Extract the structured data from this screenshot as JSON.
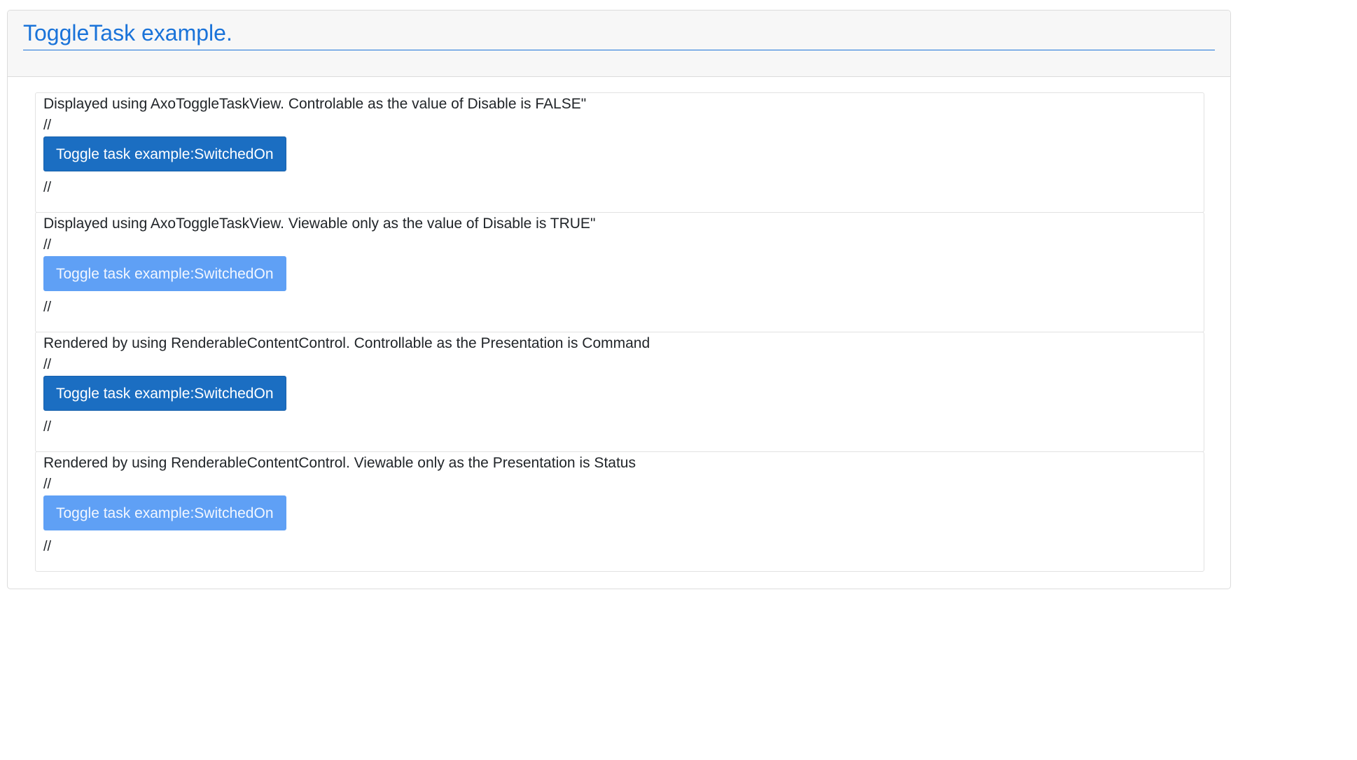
{
  "header": {
    "title": "ToggleTask example."
  },
  "panels": [
    {
      "description": "Displayed using AxoToggleTaskView. Controlable as the value of Disable is FALSE\"",
      "separator_top": "//",
      "button_label": "Toggle task example:SwitchedOn",
      "button_enabled": true,
      "separator_bottom": "//"
    },
    {
      "description": "Displayed using AxoToggleTaskView. Viewable only as the value of Disable is TRUE\"",
      "separator_top": "//",
      "button_label": "Toggle task example:SwitchedOn",
      "button_enabled": false,
      "separator_bottom": "//"
    },
    {
      "description": "Rendered by using RenderableContentControl. Controllable as the Presentation is Command",
      "separator_top": "//",
      "button_label": "Toggle task example:SwitchedOn",
      "button_enabled": true,
      "separator_bottom": "//"
    },
    {
      "description": "Rendered by using RenderableContentControl. Viewable only as the Presentation is Status",
      "separator_top": "//",
      "button_label": "Toggle task example:SwitchedOn",
      "button_enabled": false,
      "separator_bottom": "//"
    }
  ],
  "colors": {
    "accent": "#1a73d9",
    "button_enabled": "#1b6ec2",
    "button_disabled": "#5fa0f5",
    "header_bg": "#f7f7f7"
  }
}
